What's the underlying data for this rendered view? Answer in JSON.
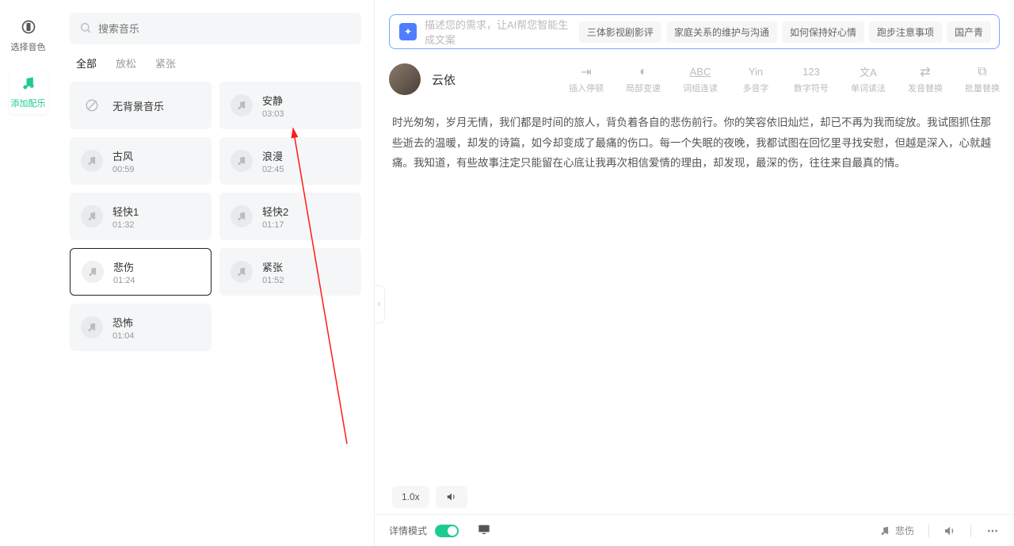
{
  "rail": {
    "timbre": "选择音色",
    "music": "添加配乐"
  },
  "search": {
    "placeholder": "搜索音乐"
  },
  "tabs": [
    "全部",
    "放松",
    "紧张"
  ],
  "tracks": [
    {
      "name": "无背景音乐",
      "dur": "",
      "none": true
    },
    {
      "name": "安静",
      "dur": "03:03"
    },
    {
      "name": "古风",
      "dur": "00:59"
    },
    {
      "name": "浪漫",
      "dur": "02:45"
    },
    {
      "name": "轻快1",
      "dur": "01:32"
    },
    {
      "name": "轻快2",
      "dur": "01:17"
    },
    {
      "name": "悲伤",
      "dur": "01:24",
      "selected": true
    },
    {
      "name": "紧张",
      "dur": "01:52"
    },
    {
      "name": "恐怖",
      "dur": "01:04"
    }
  ],
  "prompt": {
    "placeholder": "描述您的需求，让AI帮您智能生成文案",
    "suggestions": [
      "三体影视剧影评",
      "家庭关系的维护与沟通",
      "如何保持好心情",
      "跑步注意事项",
      "国产青"
    ]
  },
  "anchor": {
    "name": "云依"
  },
  "tools": [
    {
      "icon": "⇥",
      "label": "插入停顿"
    },
    {
      "icon": "◐",
      "label": "局部变速"
    },
    {
      "icon": "ABC",
      "label": "词组连读",
      "underline": true
    },
    {
      "icon": "Yin",
      "label": "多音字"
    },
    {
      "icon": "123",
      "label": "数字符号"
    },
    {
      "icon": "文A",
      "label": "单词读法"
    },
    {
      "icon": "⇄",
      "label": "发音替换"
    },
    {
      "icon": "⧉",
      "label": "批量替换"
    }
  ],
  "body": "时光匆匆，岁月无情，我们都是时间的旅人，背负着各自的悲伤前行。你的笑容依旧灿烂，却已不再为我而绽放。我试图抓住那些逝去的温暖，却发的诗篇，如今却变成了最痛的伤口。每一个失眠的夜晚，我都试图在回忆里寻找安慰，但越是深入，心就越痛。我知道，有些故事注定只能留在心底让我再次相信爱情的理由，却发现，最深的伤，往往来自最真的情。",
  "speed": "1.0x",
  "footer": {
    "detail": "详情模式",
    "now_playing": "悲伤"
  }
}
